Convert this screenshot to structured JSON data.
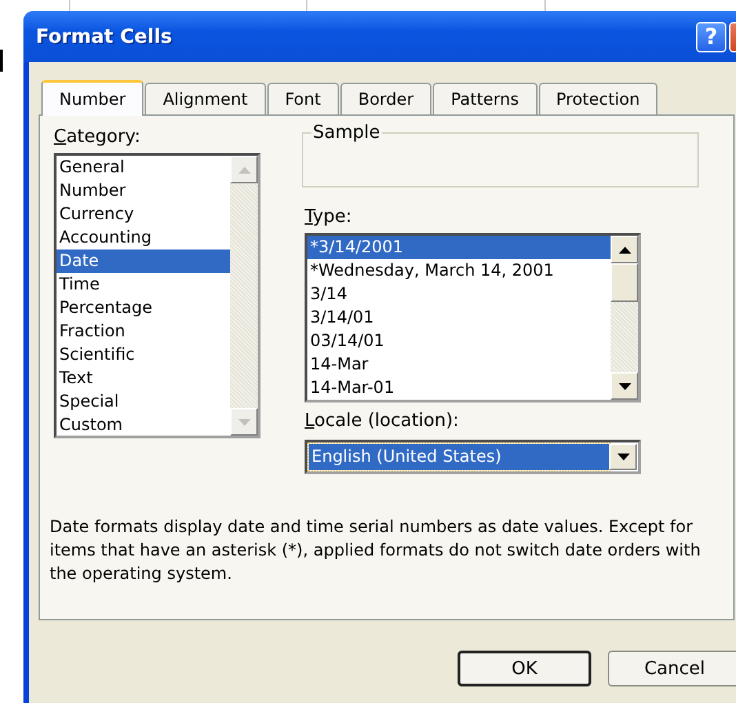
{
  "window": {
    "title": "Format Cells",
    "help_button": "?"
  },
  "tabs": [
    {
      "label": "Number",
      "selected": true
    },
    {
      "label": "Alignment",
      "selected": false
    },
    {
      "label": "Font",
      "selected": false
    },
    {
      "label": "Border",
      "selected": false
    },
    {
      "label": "Patterns",
      "selected": false
    },
    {
      "label": "Protection",
      "selected": false
    }
  ],
  "category": {
    "label": "Category:",
    "items": [
      {
        "label": "General",
        "selected": false
      },
      {
        "label": "Number",
        "selected": false
      },
      {
        "label": "Currency",
        "selected": false
      },
      {
        "label": "Accounting",
        "selected": false
      },
      {
        "label": "Date",
        "selected": true
      },
      {
        "label": "Time",
        "selected": false
      },
      {
        "label": "Percentage",
        "selected": false
      },
      {
        "label": "Fraction",
        "selected": false
      },
      {
        "label": "Scientific",
        "selected": false
      },
      {
        "label": "Text",
        "selected": false
      },
      {
        "label": "Special",
        "selected": false
      },
      {
        "label": "Custom",
        "selected": false
      }
    ]
  },
  "sample": {
    "label": "Sample"
  },
  "type": {
    "label": "Type:",
    "items": [
      {
        "label": "*3/14/2001",
        "selected": true
      },
      {
        "label": "*Wednesday, March 14, 2001",
        "selected": false
      },
      {
        "label": "3/14",
        "selected": false
      },
      {
        "label": "3/14/01",
        "selected": false
      },
      {
        "label": "03/14/01",
        "selected": false
      },
      {
        "label": "14-Mar",
        "selected": false
      },
      {
        "label": "14-Mar-01",
        "selected": false
      }
    ]
  },
  "locale": {
    "label": "Locale (location):",
    "value": "English (United States)"
  },
  "description": "Date formats display date and time serial numbers as date values. Except for items that have an asterisk (*), applied formats do not switch date orders with the operating system.",
  "buttons": [
    {
      "label": "OK",
      "default": true
    },
    {
      "label": "Cancel",
      "default": false
    }
  ]
}
